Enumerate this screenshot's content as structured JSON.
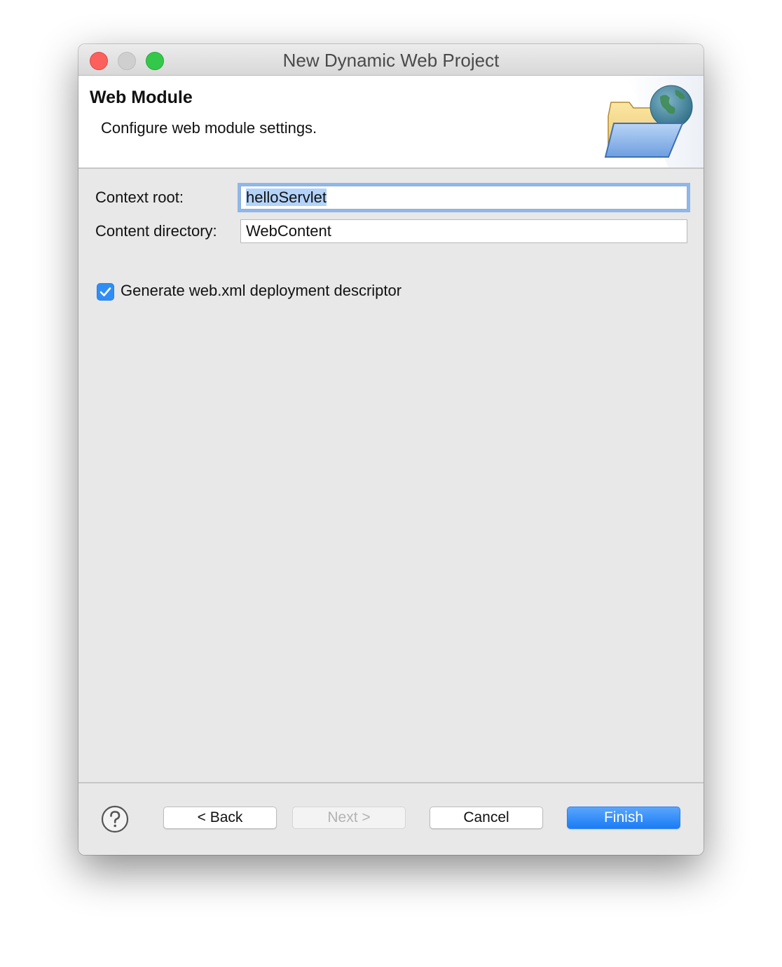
{
  "window": {
    "title": "New Dynamic Web Project"
  },
  "banner": {
    "title": "Web Module",
    "description": "Configure web module settings."
  },
  "form": {
    "context_root_label": "Context root:",
    "context_root_value": "helloServlet",
    "content_directory_label": "Content directory:",
    "content_directory_value": "WebContent",
    "generate_descriptor_label": "Generate web.xml deployment descriptor",
    "generate_descriptor_checked": true
  },
  "buttons": {
    "back": "< Back",
    "next": "Next >",
    "cancel": "Cancel",
    "finish": "Finish"
  },
  "icons": {
    "help": "help-icon",
    "banner": "folder-globe-icon",
    "check": "checkmark-icon"
  },
  "colors": {
    "accent": "#1a7cf5",
    "close": "#fc605c",
    "zoom": "#34c84a",
    "selection": "#b3d3f9"
  }
}
